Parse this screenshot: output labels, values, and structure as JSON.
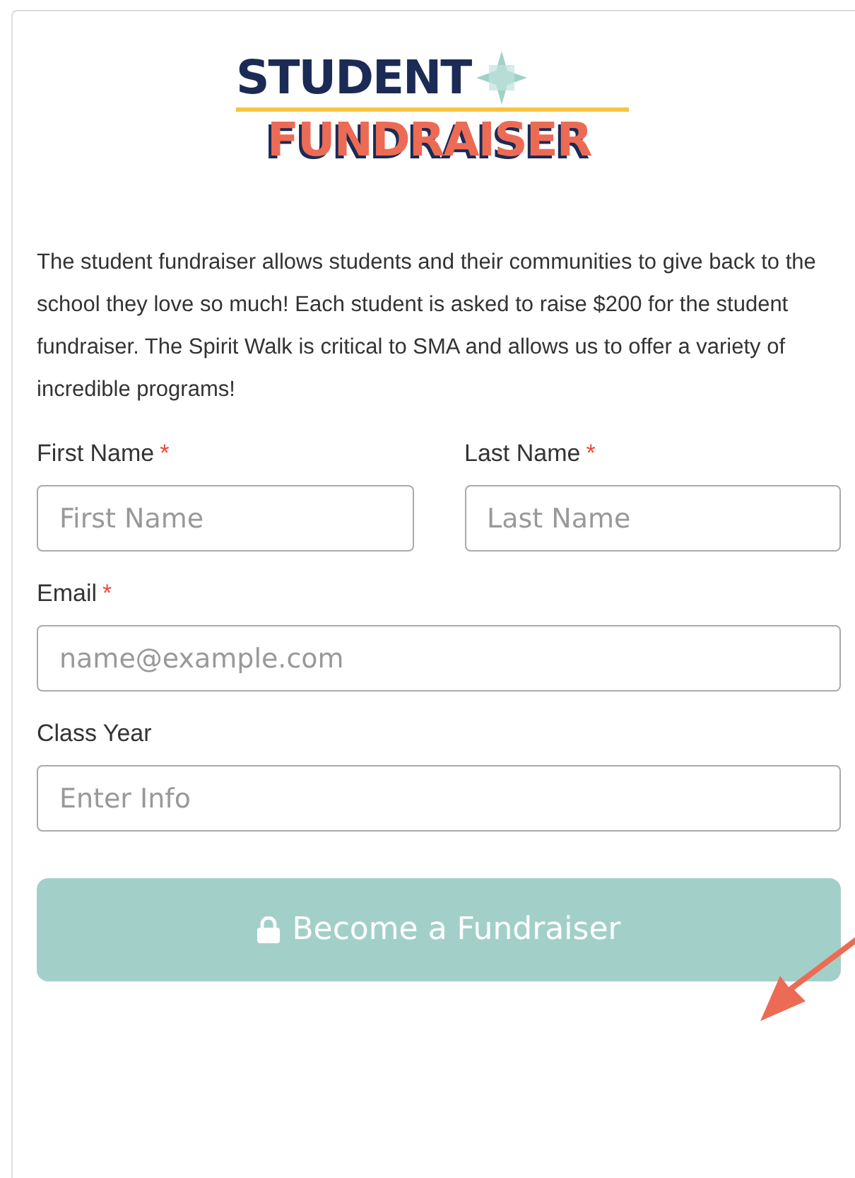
{
  "logo": {
    "line_1": "STUDENT",
    "line_2": "FUNDRAISER"
  },
  "description": "The student fundraiser allows students and their communities to give back to the school they love so much! Each student is asked to raise $200 for the student fundraiser. The Spirit Walk is critical to SMA and allows us to offer a variety of incredible programs!",
  "rows": [
    {
      "fields": [
        {
          "label": "First Name",
          "required": true,
          "placeholder": "First Name"
        },
        {
          "label": "Last Name",
          "required": true,
          "placeholder": "Last Name"
        }
      ]
    },
    {
      "fields": [
        {
          "label": "Email",
          "required": true,
          "placeholder": "name@example.com"
        }
      ]
    },
    {
      "fields": [
        {
          "label": "Class Year",
          "required": false,
          "placeholder": "Enter Info"
        }
      ]
    }
  ],
  "submit_button": {
    "label": "Become a Fundraiser"
  },
  "required_mark": "*"
}
